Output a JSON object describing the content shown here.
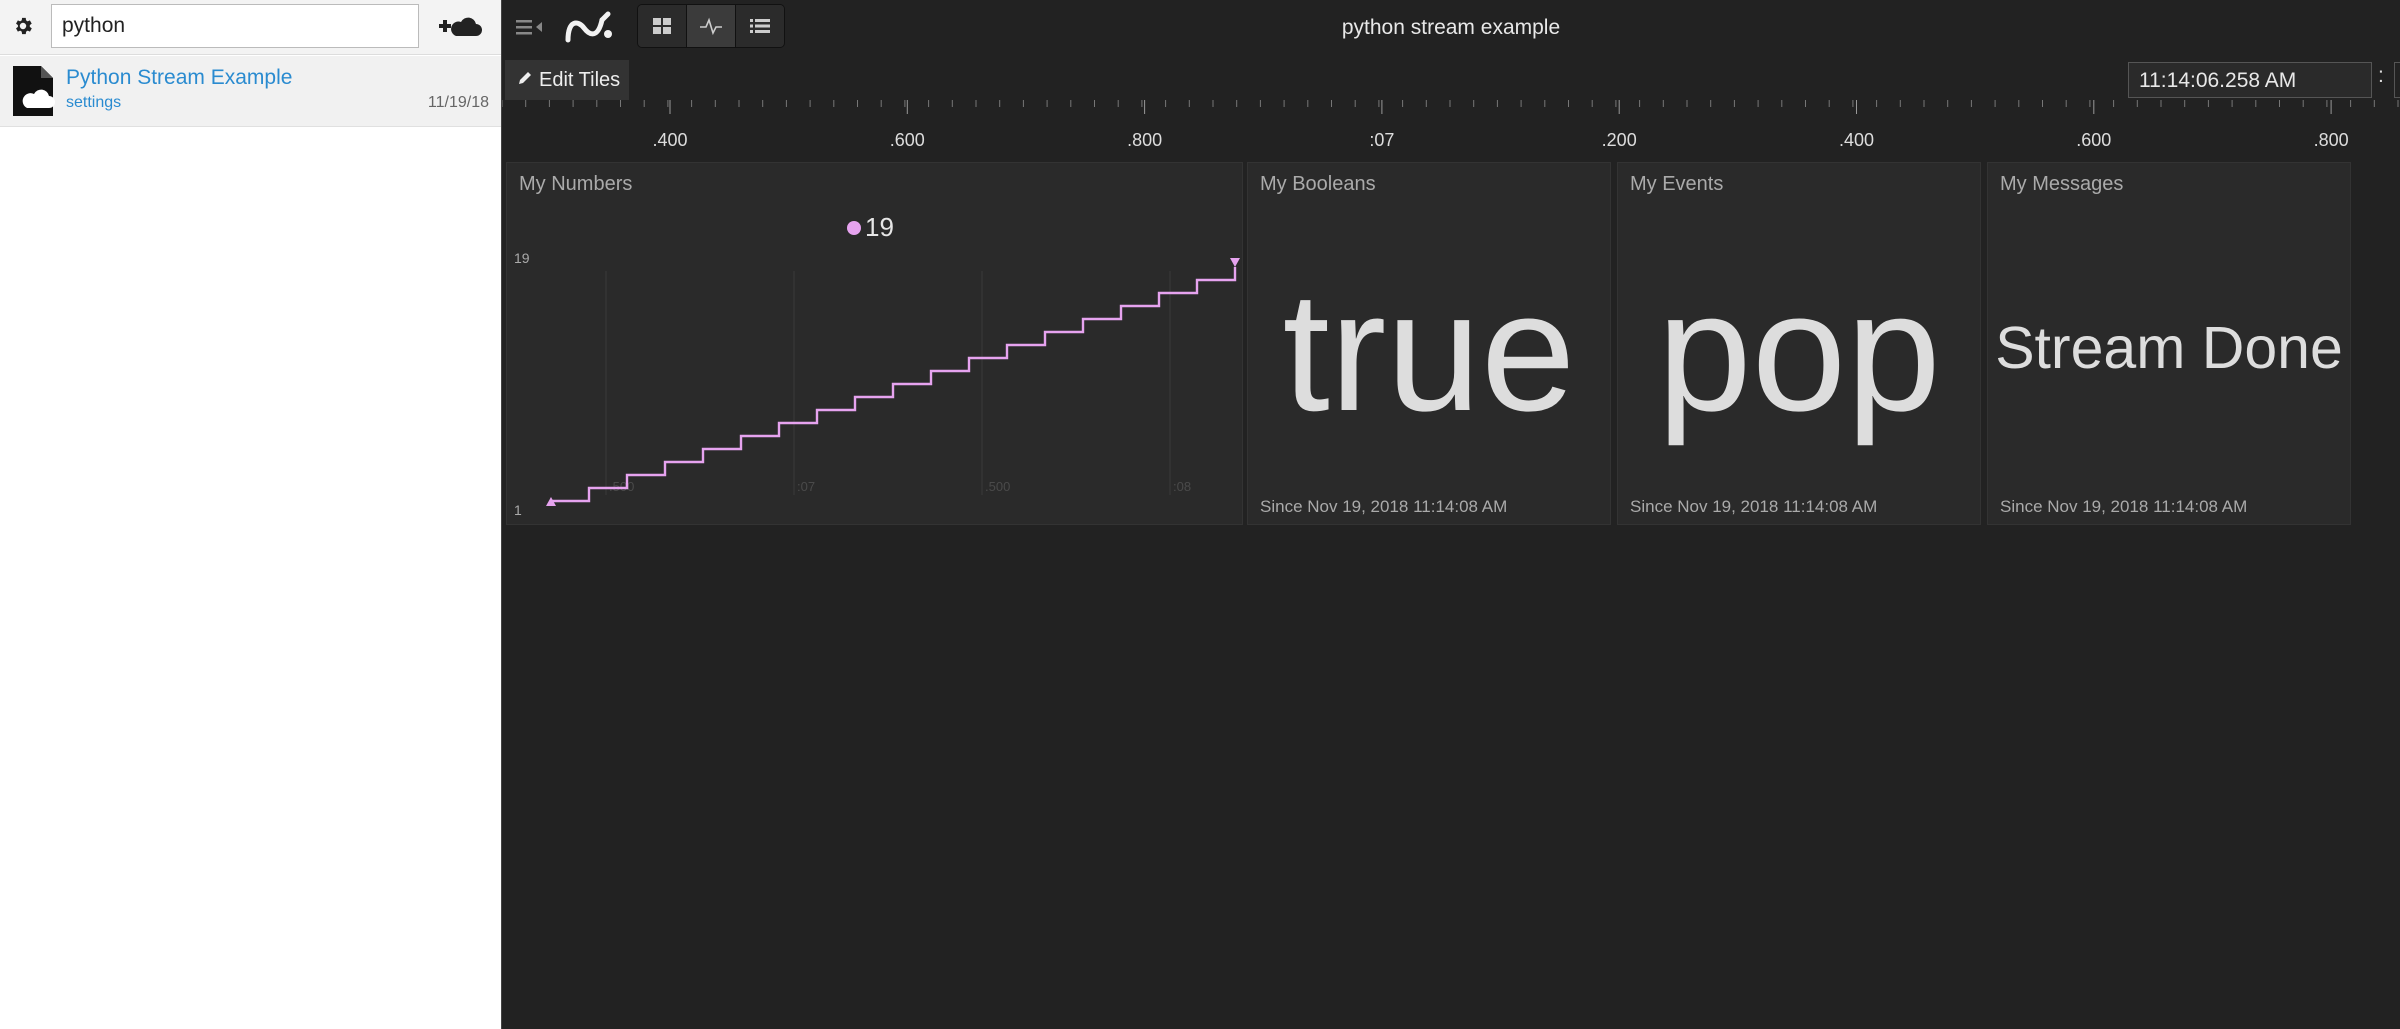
{
  "sidebar": {
    "gear_icon": "gear-icon",
    "search_value": "python",
    "add_icon": "add-cloud-icon",
    "items": [
      {
        "title": "Python Stream Example",
        "subtitle": "settings",
        "date": "11/19/18",
        "icon": "cloud-document-icon"
      }
    ]
  },
  "topbar": {
    "title": "python stream example",
    "menu_icon": "menu-collapse-icon",
    "logo_icon": "app-logo-icon",
    "views": [
      "grid-view-icon",
      "stream-view-icon",
      "list-view-icon"
    ],
    "active_view": "stream-view-icon"
  },
  "toolbar": {
    "edit_tiles_label": "Edit Tiles",
    "time_value": "11:14:06.258 AM",
    "time_colon": ":"
  },
  "timeline": {
    "labels": [
      ".400",
      ".600",
      ".800",
      ":07",
      ".200",
      ".400",
      ".600",
      ".800"
    ]
  },
  "tiles": {
    "numbers": {
      "title": "My Numbers",
      "legend_value": "19",
      "y_max_label": "19",
      "y_min_label": "1",
      "x_labels": [
        ".500",
        ":07",
        ".500",
        ":08"
      ]
    },
    "booleans": {
      "title": "My Booleans",
      "value": "true",
      "since": "Since Nov 19, 2018 11:14:08 AM"
    },
    "events": {
      "title": "My Events",
      "value": "pop",
      "since": "Since Nov 19, 2018 11:14:08 AM"
    },
    "messages": {
      "title": "My Messages",
      "value": "Stream Done",
      "since": "Since Nov 19, 2018 11:14:08 AM"
    }
  },
  "colors": {
    "accent": "#e6a3ef",
    "link": "#2a8bd0",
    "background": "#222222",
    "tile": "#2a2a2a"
  },
  "chart_data": {
    "type": "line",
    "x": [
      1,
      2,
      3,
      4,
      5,
      6,
      7,
      8,
      9,
      10,
      11,
      12,
      13,
      14,
      15,
      16,
      17,
      18,
      19
    ],
    "values": [
      1,
      2,
      3,
      4,
      5,
      6,
      7,
      8,
      9,
      10,
      11,
      12,
      13,
      14,
      15,
      16,
      17,
      18,
      19
    ],
    "ylim": [
      1,
      19
    ],
    "series_color": "#e6a3ef",
    "step": true,
    "grid": true
  }
}
